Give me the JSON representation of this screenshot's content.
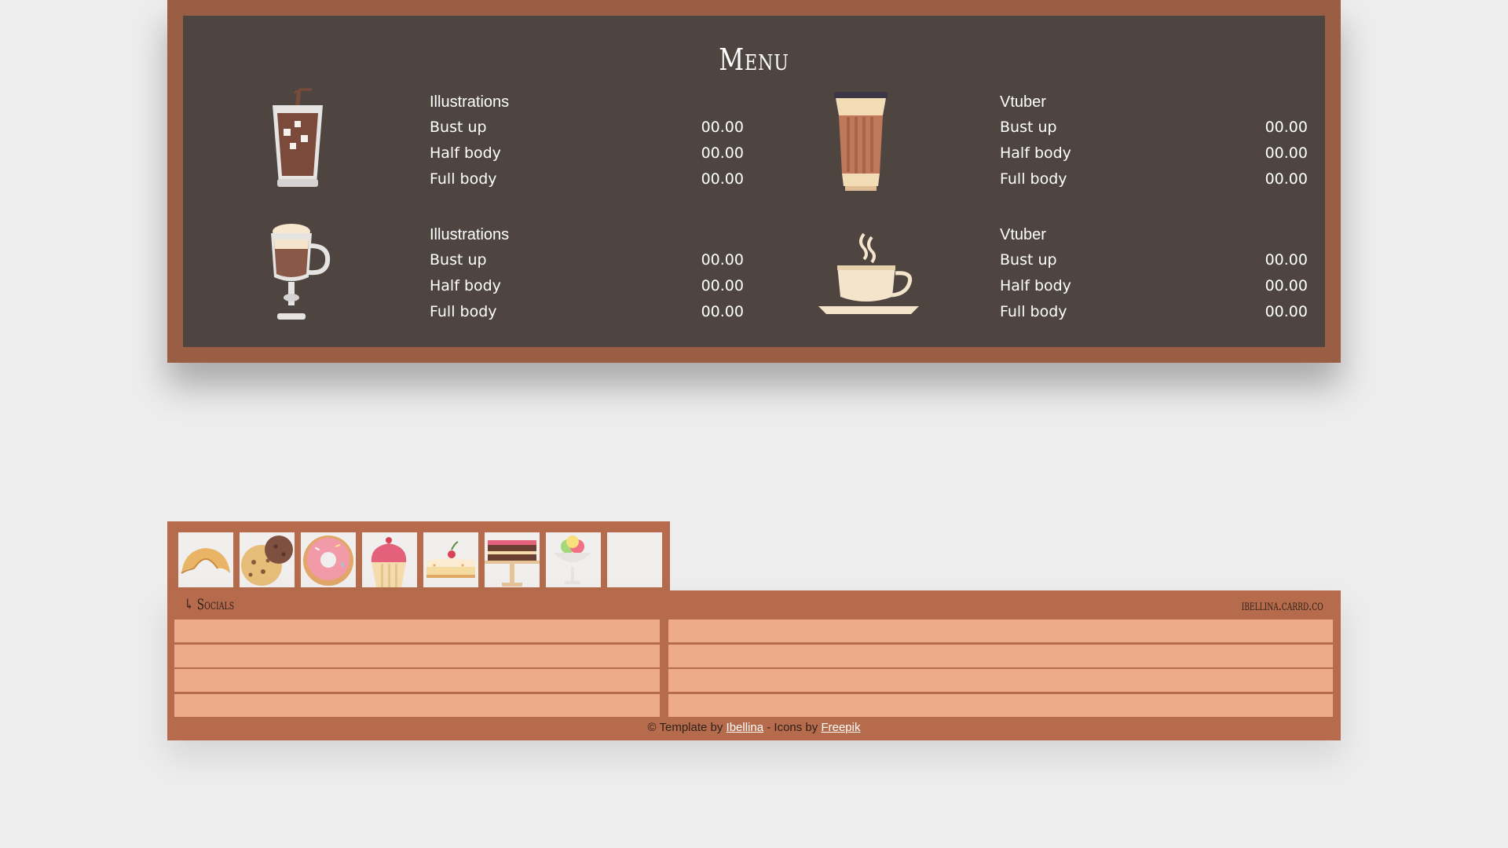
{
  "menu": {
    "title": "Menu",
    "sections": [
      {
        "icon": "iced-coffee-icon",
        "heading": "Illustrations",
        "items": [
          {
            "name": "Bust up",
            "price": "00.00"
          },
          {
            "name": "Half body",
            "price": "00.00"
          },
          {
            "name": "Full body",
            "price": "00.00"
          }
        ]
      },
      {
        "icon": "takeaway-cup-icon",
        "heading": "Vtuber",
        "items": [
          {
            "name": "Bust up",
            "price": "00.00"
          },
          {
            "name": "Half body",
            "price": "00.00"
          },
          {
            "name": "Full body",
            "price": "00.00"
          }
        ]
      },
      {
        "icon": "irish-coffee-glass-icon",
        "heading": "Illustrations",
        "items": [
          {
            "name": "Bust up",
            "price": "00.00"
          },
          {
            "name": "Half body",
            "price": "00.00"
          },
          {
            "name": "Full body",
            "price": "00.00"
          }
        ]
      },
      {
        "icon": "hot-coffee-cup-icon",
        "heading": "Vtuber",
        "items": [
          {
            "name": "Bust up",
            "price": "00.00"
          },
          {
            "name": "Half body",
            "price": "00.00"
          },
          {
            "name": "Full body",
            "price": "00.00"
          }
        ]
      }
    ]
  },
  "sweets": [
    {
      "icon": "croissant-icon"
    },
    {
      "icon": "cookie-icon"
    },
    {
      "icon": "donut-icon"
    },
    {
      "icon": "cupcake-icon"
    },
    {
      "icon": "cake-slice-icon"
    },
    {
      "icon": "layer-cake-icon"
    },
    {
      "icon": "ice-cream-icon"
    },
    {
      "icon": "empty-tile"
    }
  ],
  "socials": {
    "title": "↳ Socials",
    "site": "ibellina.carrd.co"
  },
  "footer": {
    "prefix": "© Template by ",
    "author_link": "Ibellina",
    "middle": " - Icons by ",
    "icons_link": "Freepik"
  },
  "colors": {
    "frame": "#9a5e45",
    "board": "#4e4540",
    "panel": "#b66c4c",
    "row": "#eeab8b",
    "background": "#ededed"
  }
}
